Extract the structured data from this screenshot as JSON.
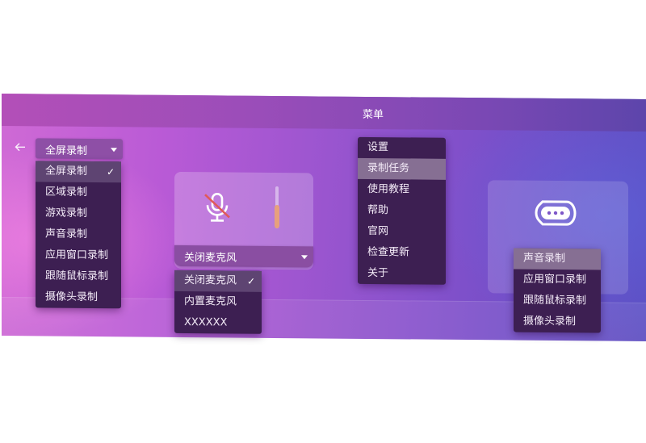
{
  "header": {
    "title": "菜单"
  },
  "left_combo": {
    "value": "全屏录制",
    "options": [
      "全屏录制",
      "区域录制",
      "游戏录制",
      "声音录制",
      "应用窗口录制",
      "跟随鼠标录制",
      "摄像头录制"
    ],
    "selected_index": 0
  },
  "audio": {
    "combo_value": "关闭麦克风",
    "options": [
      "关闭麦克风",
      "内置麦克风",
      "XXXXXX"
    ],
    "selected_index": 0,
    "mic_state": "muted",
    "volume_level": 0.55
  },
  "main_menu": {
    "items": [
      "设置",
      "录制任务",
      "使用教程",
      "帮助",
      "官网",
      "检查更新",
      "关于"
    ],
    "highlighted_index": 1
  },
  "right_menu": {
    "items": [
      "声音录制",
      "应用窗口录制",
      "跟随鼠标录制",
      "摄像头录制"
    ],
    "highlighted_index": 0
  },
  "icons": {
    "back": "arrow-left-icon",
    "check": "check-icon",
    "mic": "microphone-muted-icon",
    "more": "more-options-icon"
  },
  "colors": {
    "menu_bg": "#3d1f52",
    "menu_highlight": "#5e4472",
    "accent": "#8e4fa6",
    "slider_fill": "#e7a07d"
  }
}
